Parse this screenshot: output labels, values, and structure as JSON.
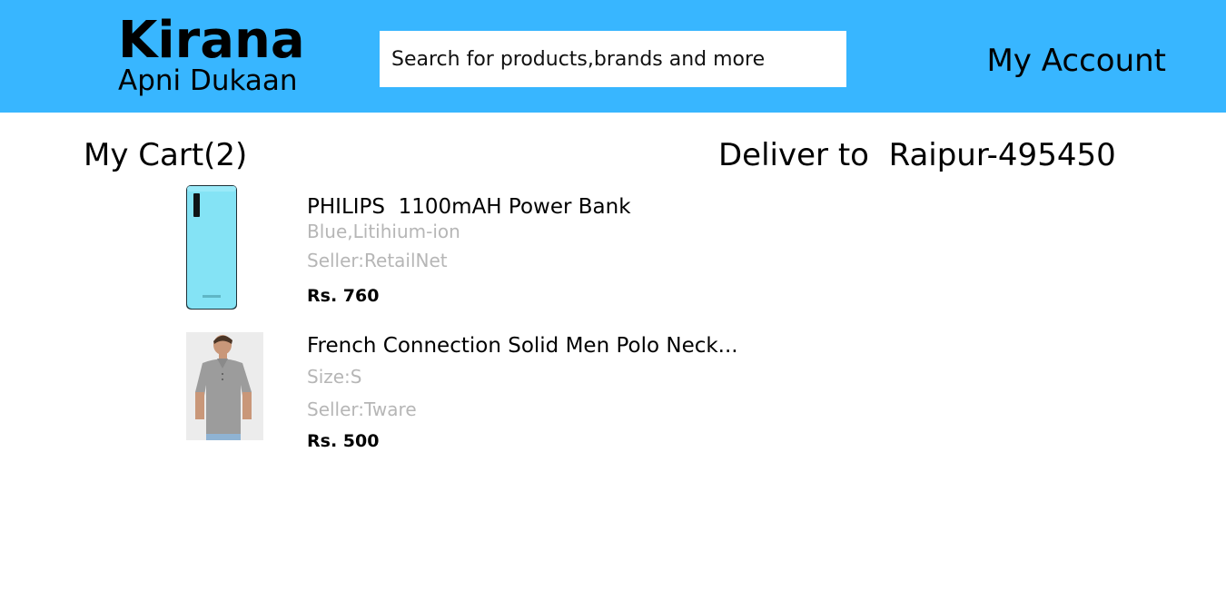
{
  "header": {
    "brand_title": "Kirana",
    "brand_subtitle": "Apni Dukaan",
    "search_placeholder": "Search for products,brands and more",
    "account_label": "My Account",
    "background_color": "#38b6ff"
  },
  "cart": {
    "title": "My Cart(2)",
    "deliver_label": "Deliver to  Raipur-495450",
    "items": [
      {
        "name": "PHILIPS  1100mAH Power Bank",
        "variant": "Blue,Litihium-ion",
        "seller": "Seller:RetailNet",
        "price": "Rs. 760",
        "image_icon": "power-bank-image"
      },
      {
        "name": "French Connection Solid Men Polo Neck...",
        "variant": "Size:S",
        "seller": "Seller:Tware",
        "price": "Rs. 500",
        "image_icon": "polo-shirt-image"
      }
    ]
  }
}
